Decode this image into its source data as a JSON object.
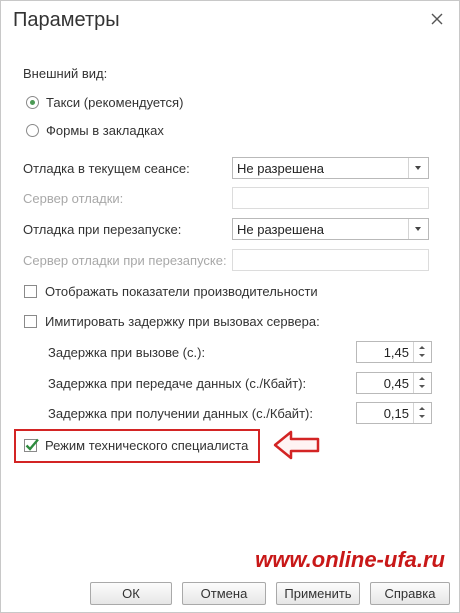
{
  "window": {
    "title": "Параметры"
  },
  "appearance": {
    "label": "Внешний вид:",
    "options": [
      {
        "label": "Такси (рекомендуется)",
        "selected": true
      },
      {
        "label": "Формы в закладках",
        "selected": false
      }
    ]
  },
  "debug_session": {
    "label": "Отладка в текущем сеансе:",
    "value": "Не разрешена"
  },
  "debug_server": {
    "label": "Сервер отладки:",
    "value": ""
  },
  "debug_restart": {
    "label": "Отладка при перезапуске:",
    "value": "Не разрешена"
  },
  "debug_restart_server": {
    "label": "Сервер отладки при перезапуске:",
    "value": ""
  },
  "show_performance": {
    "label": "Отображать показатели производительности",
    "checked": false
  },
  "simulate_delay": {
    "label": "Имитировать задержку при вызовах сервера:",
    "checked": false
  },
  "delays": [
    {
      "label": "Задержка при вызове (с.):",
      "value": "1,45"
    },
    {
      "label": "Задержка при передаче данных (с./Кбайт):",
      "value": "0,45"
    },
    {
      "label": "Задержка при получении данных (с./Кбайт):",
      "value": "0,15"
    }
  ],
  "tech_mode": {
    "label": "Режим технического специалиста",
    "checked": true
  },
  "watermark": "www.online-ufa.ru",
  "buttons": {
    "ok": "ОК",
    "cancel": "Отмена",
    "apply": "Применить",
    "help": "Справка"
  },
  "colors": {
    "highlight": "#d32424",
    "checkmark": "#2e8b3e",
    "radio_dot": "#4c9a55"
  }
}
